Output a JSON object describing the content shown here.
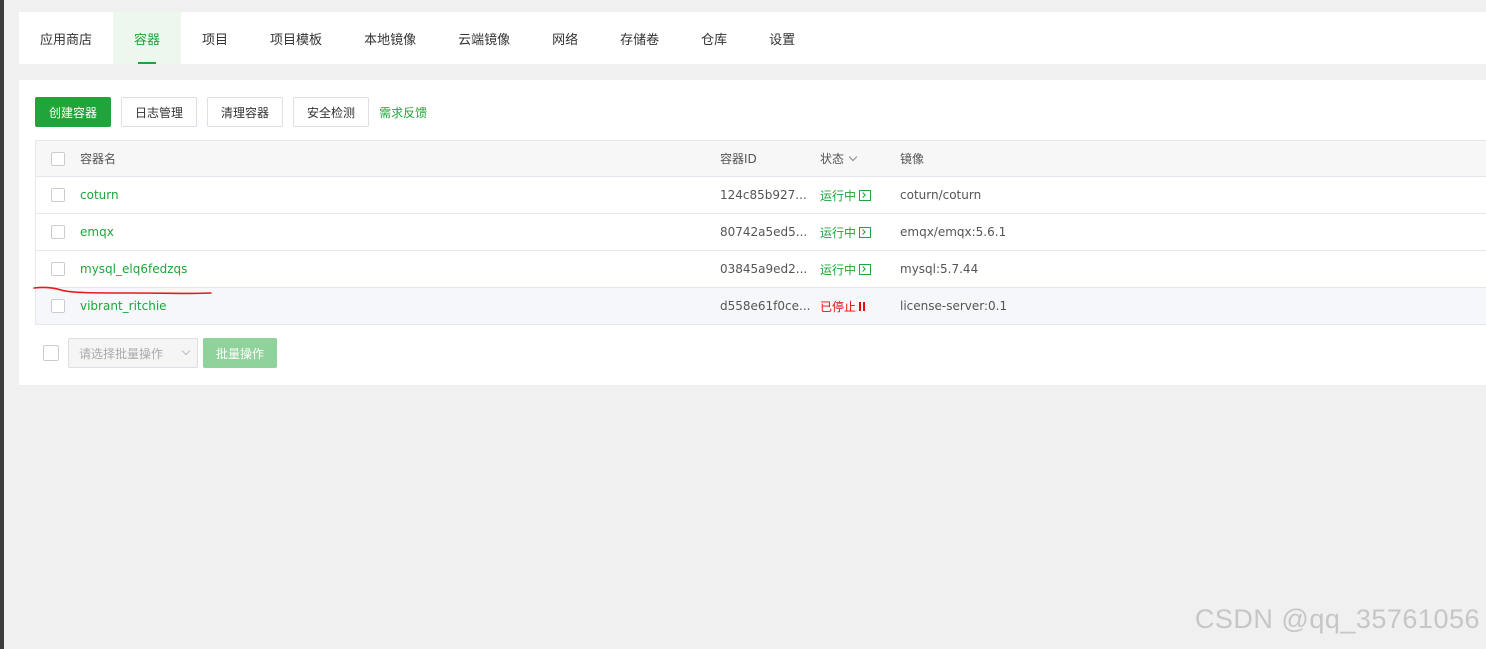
{
  "nav": {
    "tabs": [
      {
        "label": "应用商店",
        "active": false
      },
      {
        "label": "容器",
        "active": true
      },
      {
        "label": "项目",
        "active": false
      },
      {
        "label": "项目模板",
        "active": false
      },
      {
        "label": "本地镜像",
        "active": false
      },
      {
        "label": "云端镜像",
        "active": false
      },
      {
        "label": "网络",
        "active": false
      },
      {
        "label": "存储卷",
        "active": false
      },
      {
        "label": "仓库",
        "active": false
      },
      {
        "label": "设置",
        "active": false
      }
    ]
  },
  "toolbar": {
    "create_label": "创建容器",
    "logs_label": "日志管理",
    "clean_label": "清理容器",
    "security_label": "安全检测",
    "feedback_label": "需求反馈"
  },
  "table": {
    "headers": {
      "name": "容器名",
      "id": "容器ID",
      "status": "状态",
      "image": "镜像"
    },
    "rows": [
      {
        "name": "coturn",
        "id": "124c85b927...",
        "status": "运行中",
        "status_kind": "running",
        "image": "coturn/coturn"
      },
      {
        "name": "emqx",
        "id": "80742a5ed5...",
        "status": "运行中",
        "status_kind": "running",
        "image": "emqx/emqx:5.6.1"
      },
      {
        "name": "mysql_elq6fedzqs",
        "id": "03845a9ed2...",
        "status": "运行中",
        "status_kind": "running",
        "image": "mysql:5.7.44"
      },
      {
        "name": "vibrant_ritchie",
        "id": "d558e61f0ce...",
        "status": "已停止",
        "status_kind": "stopped",
        "image": "license-server:0.1"
      }
    ]
  },
  "bottom": {
    "batch_select_placeholder": "请选择批量操作",
    "batch_button": "批量操作"
  },
  "colors": {
    "accent": "#20a53a",
    "stopped": "#ef0808",
    "annotation": "#e8191b"
  },
  "watermark": "CSDN @qq_35761056"
}
